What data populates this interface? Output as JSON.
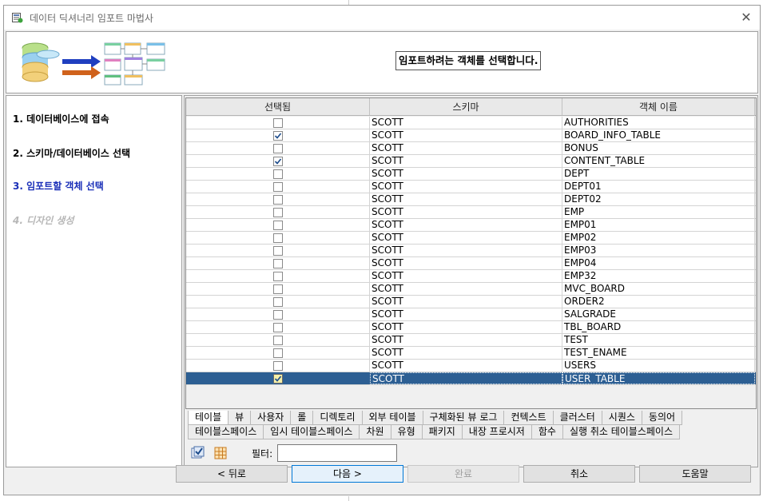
{
  "window": {
    "title": "데이터 딕셔너리 임포트 마법사"
  },
  "header": {
    "message": "임포트하려는 객체를 선택합니다."
  },
  "steps": [
    {
      "label": "1. 데이터베이스에 접속",
      "state": "done"
    },
    {
      "label": "2. 스키마/데이터베이스 선택",
      "state": "done"
    },
    {
      "label": "3. 임포트할 객체 선택",
      "state": "active"
    },
    {
      "label": "4. 디자인 생성",
      "state": "disabled"
    }
  ],
  "grid": {
    "columns": [
      "선택됨",
      "스키마",
      "객체 이름"
    ],
    "rows": [
      {
        "checked": false,
        "schema": "SCOTT",
        "name": "AUTHORITIES"
      },
      {
        "checked": true,
        "schema": "SCOTT",
        "name": "BOARD_INFO_TABLE"
      },
      {
        "checked": false,
        "schema": "SCOTT",
        "name": "BONUS"
      },
      {
        "checked": true,
        "schema": "SCOTT",
        "name": "CONTENT_TABLE"
      },
      {
        "checked": false,
        "schema": "SCOTT",
        "name": "DEPT"
      },
      {
        "checked": false,
        "schema": "SCOTT",
        "name": "DEPT01"
      },
      {
        "checked": false,
        "schema": "SCOTT",
        "name": "DEPT02"
      },
      {
        "checked": false,
        "schema": "SCOTT",
        "name": "EMP"
      },
      {
        "checked": false,
        "schema": "SCOTT",
        "name": "EMP01"
      },
      {
        "checked": false,
        "schema": "SCOTT",
        "name": "EMP02"
      },
      {
        "checked": false,
        "schema": "SCOTT",
        "name": "EMP03"
      },
      {
        "checked": false,
        "schema": "SCOTT",
        "name": "EMP04"
      },
      {
        "checked": false,
        "schema": "SCOTT",
        "name": "EMP32"
      },
      {
        "checked": false,
        "schema": "SCOTT",
        "name": "MVC_BOARD"
      },
      {
        "checked": false,
        "schema": "SCOTT",
        "name": "ORDER2"
      },
      {
        "checked": false,
        "schema": "SCOTT",
        "name": "SALGRADE"
      },
      {
        "checked": false,
        "schema": "SCOTT",
        "name": "TBL_BOARD"
      },
      {
        "checked": false,
        "schema": "SCOTT",
        "name": "TEST"
      },
      {
        "checked": false,
        "schema": "SCOTT",
        "name": "TEST_ENAME"
      },
      {
        "checked": false,
        "schema": "SCOTT",
        "name": "USERS"
      },
      {
        "checked": true,
        "schema": "SCOTT",
        "name": "USER_TABLE",
        "selected": true
      }
    ]
  },
  "tabs_row1": [
    "테이블",
    "뷰",
    "사용자",
    "롤",
    "디렉토리",
    "외부 테이블",
    "구체화된 뷰 로그",
    "컨텍스트",
    "클러스터",
    "시퀀스",
    "동의어"
  ],
  "tabs_row2": [
    "테이블스페이스",
    "임시 테이블스페이스",
    "차원",
    "유형",
    "패키지",
    "내장 프로시저",
    "함수",
    "실행 취소 테이블스페이스"
  ],
  "active_tab": "테이블",
  "filter": {
    "label": "필터:",
    "value": ""
  },
  "buttons": {
    "back": "< 뒤로",
    "next": "다음 >",
    "finish": "완료",
    "cancel": "취소",
    "help": "도움말"
  },
  "icons": {
    "app": "wizard-icon",
    "close": "close-icon",
    "select_all": "select-all-icon",
    "table_view": "table-icon"
  },
  "colors": {
    "selection": "#2d5f93",
    "active_step": "#1a2fb8",
    "disabled_step": "#b7b7b7"
  }
}
